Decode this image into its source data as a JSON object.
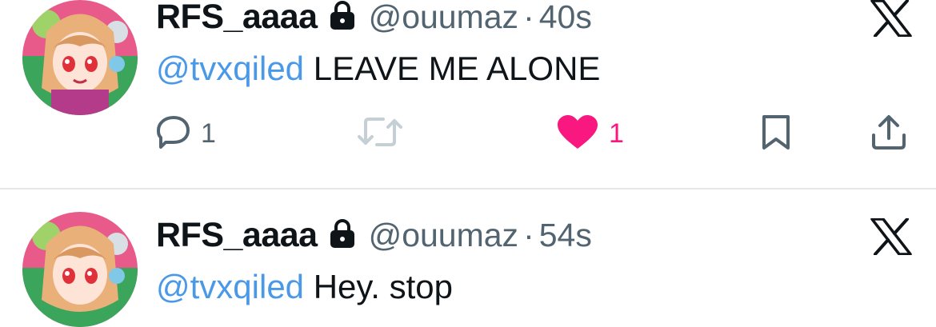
{
  "tweets": [
    {
      "display_name": "RFS_aaaa",
      "handle": "@ouumaz",
      "separator": "·",
      "time": "40s",
      "mention": "@tvxqiled",
      "text": "LEAVE ME ALONE",
      "reply_count": "1",
      "like_count": "1",
      "liked": true
    },
    {
      "display_name": "RFS_aaaa",
      "handle": "@ouumaz",
      "separator": "·",
      "time": "54s",
      "mention": "@tvxqiled",
      "text": "Hey. stop"
    }
  ],
  "colors": {
    "mention": "#4a99e9",
    "like": "#f91880",
    "muted": "#536471",
    "disabled": "#c4cfd6",
    "text": "#0f1419"
  },
  "icons": {
    "lock": "lock-icon",
    "dismiss": "x-close-icon",
    "reply": "reply-icon",
    "retweet": "retweet-icon",
    "like": "heart-icon",
    "bookmark": "bookmark-icon",
    "share": "share-icon"
  }
}
